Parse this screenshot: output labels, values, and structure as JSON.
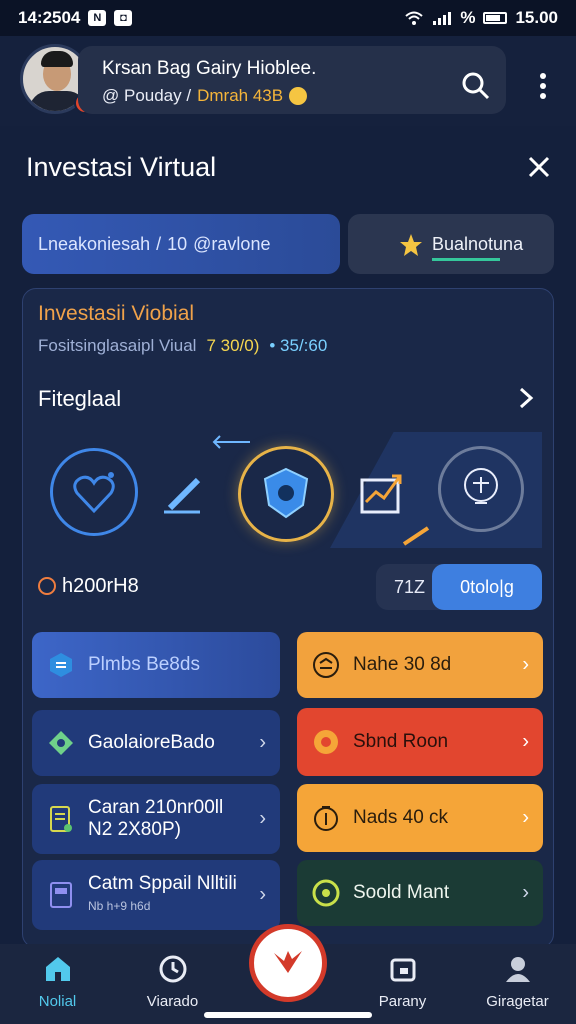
{
  "status": {
    "time": "14:2504",
    "clock": "15.00",
    "battery_pct": "%"
  },
  "header": {
    "title": "Krsan Bag Gairy Hioblee.",
    "subtitle_prefix": "@ Pouday /",
    "subtitle_highlight": "Dmrah 43B"
  },
  "panel": {
    "title": "Investasi Virtual"
  },
  "pills": {
    "left": {
      "a": "Lneakoniesah",
      "sep": "/",
      "b": "10",
      "c": "@ravlone"
    },
    "right": {
      "label": "Bualnotuna"
    }
  },
  "card": {
    "heading": "Investasii Viobial",
    "subline": "Fositsinglasaipl Viual",
    "val_yellow": "7 30/0)",
    "val_blue": "• 35/:60",
    "section": "Fiteglaal"
  },
  "stats": {
    "left": "h200rH8",
    "right_value": "71Z",
    "right_button": "0tolo|g"
  },
  "tiles_left": [
    {
      "label": "Plmbs Be8ds"
    },
    {
      "label": "GaolaioreBado"
    },
    {
      "label": "Caran 210nr00ll",
      "sub": "N2 2X80P)"
    },
    {
      "label": "Catm Sppail Nlltili",
      "sub": "Nb h+9 h6d"
    }
  ],
  "tiles_right": [
    {
      "label": "Nahe 30 8d"
    },
    {
      "label": "Sbnd Roon"
    },
    {
      "label": "Nads 40 ck"
    },
    {
      "label": "Soold Mant"
    }
  ],
  "nav": [
    {
      "label": "Nolial",
      "icon": "home-icon"
    },
    {
      "label": "Viarado",
      "icon": "clock-icon"
    },
    {
      "label": "",
      "icon": "fab-icon"
    },
    {
      "label": "Parany",
      "icon": "wallet-icon"
    },
    {
      "label": "Giragetar",
      "icon": "profile-icon"
    }
  ],
  "colors": {
    "accent_blue": "#3e7fe0",
    "accent_orange": "#f2a23d",
    "accent_red": "#e2462f",
    "nav_active": "#52c9ec"
  }
}
